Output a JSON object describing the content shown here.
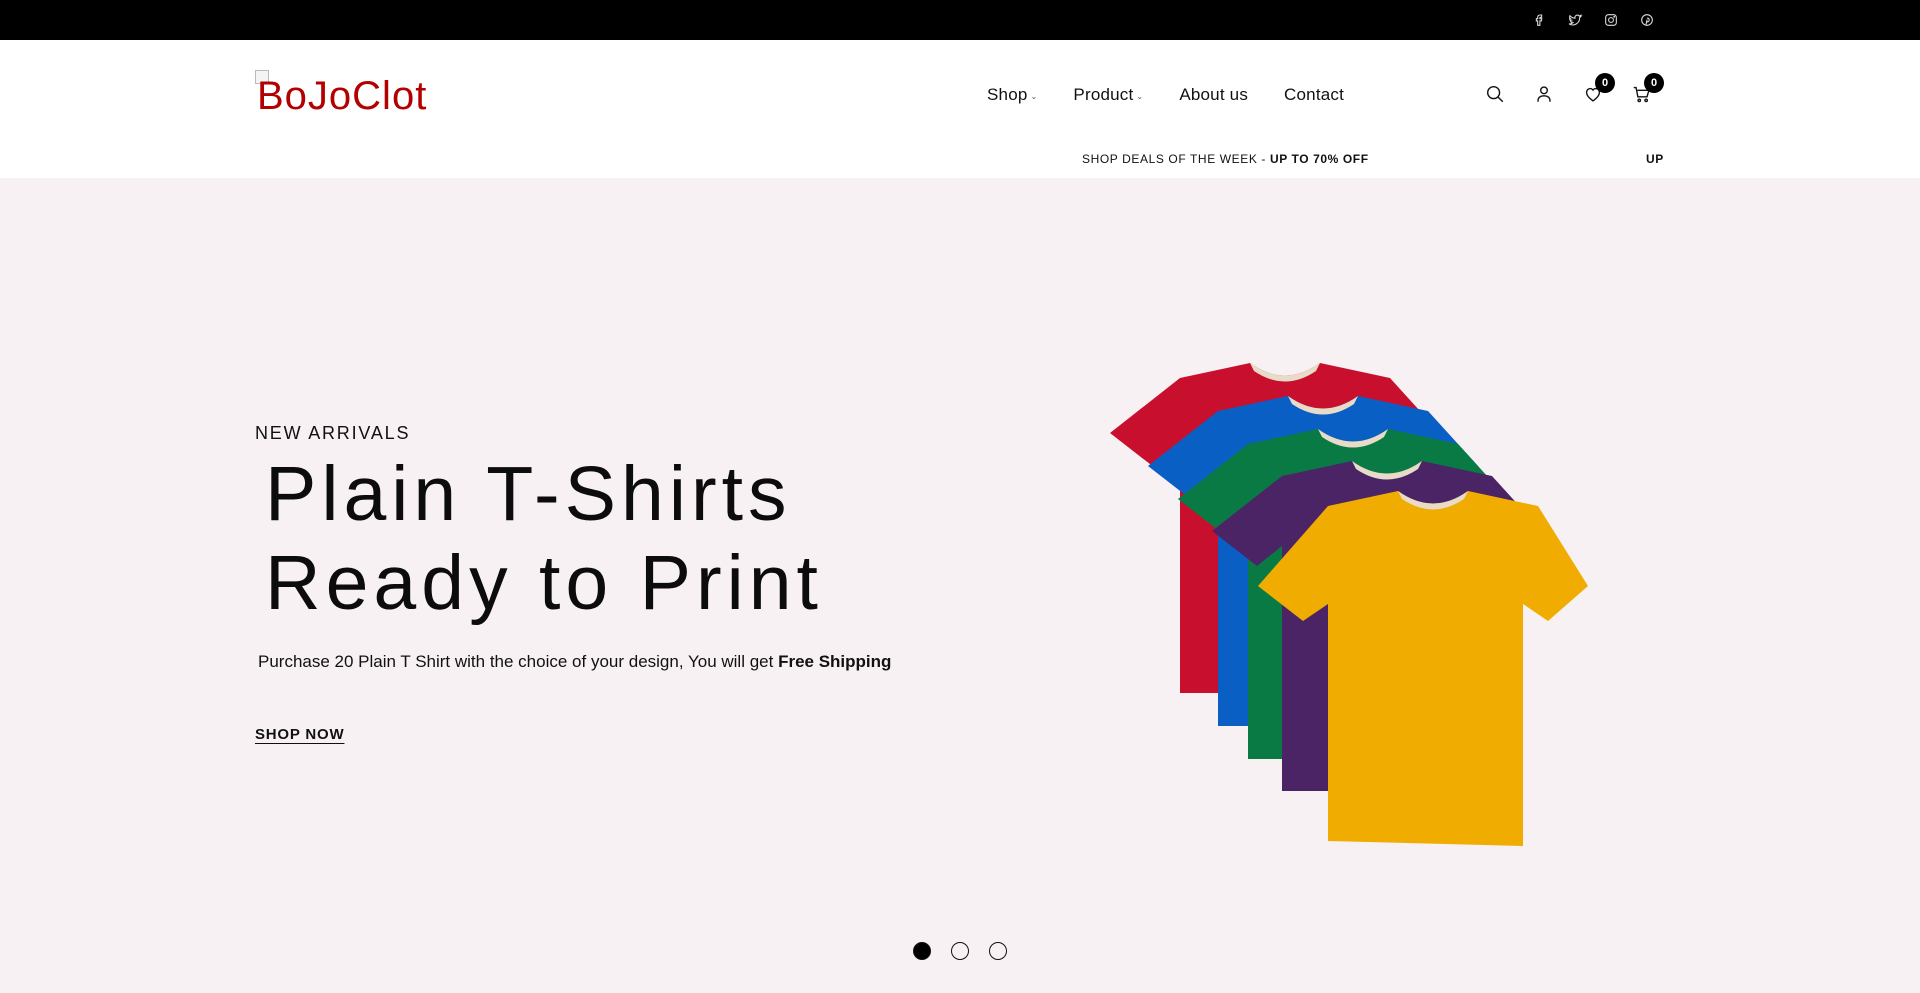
{
  "social": {
    "icons": [
      "facebook-icon",
      "twitter-icon",
      "instagram-icon",
      "pinterest-icon"
    ]
  },
  "header": {
    "logo_alt": "BoJoClot",
    "nav": [
      {
        "label": "Shop",
        "has_dropdown": true
      },
      {
        "label": "Product",
        "has_dropdown": true
      },
      {
        "label": "About us",
        "has_dropdown": false
      },
      {
        "label": "Contact",
        "has_dropdown": false
      }
    ],
    "icons": {
      "wishlist_count": "0",
      "cart_count": "0"
    }
  },
  "promo": {
    "text": "SHOP DEALS OF THE WEEK - ",
    "highlight": "UP TO 70% OFF",
    "tail": "UP"
  },
  "hero": {
    "eyebrow": "NEW ARRIVALS",
    "headline_line1": "Plain T-Shirts",
    "headline_line2": "Ready to Print",
    "subtext": "Purchase 20 Plain T Shirt with the choice of your design, You will get ",
    "subtext_bold": "Free Shipping",
    "cta": "SHOP NOW",
    "slides": 3,
    "active_slide": 1,
    "shirt_colors": [
      "#c8102e",
      "#0a5fc4",
      "#0a7a45",
      "#4b2466",
      "#f0ac00"
    ]
  },
  "colors": {
    "topbar": "#000000",
    "hero_bg": "#f8f1f3",
    "logo": "#b30000"
  }
}
